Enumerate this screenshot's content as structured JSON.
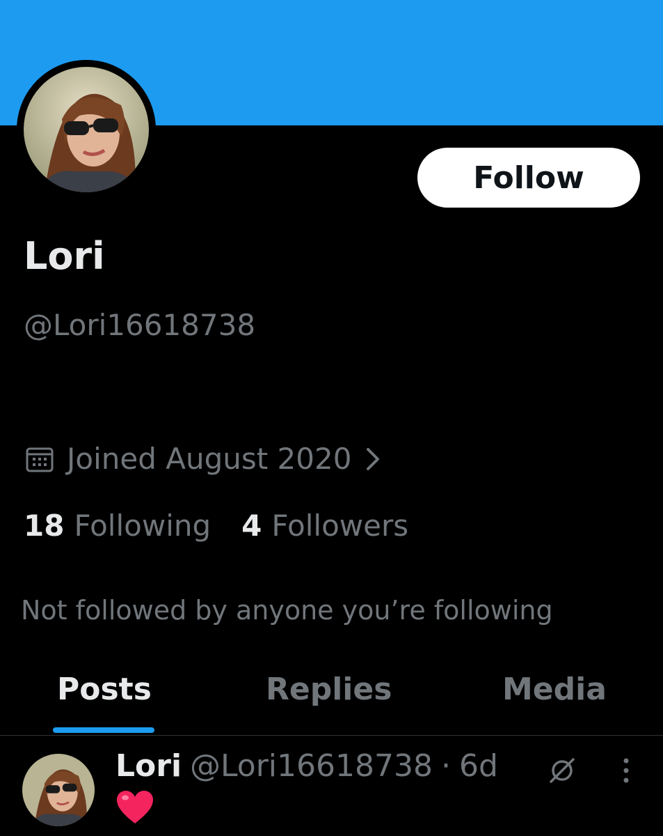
{
  "profile": {
    "display_name": "Lori",
    "handle": "@Lori16618738",
    "joined": "Joined August 2020",
    "following_count": "18",
    "following_label": "Following",
    "followers_count": "4",
    "followers_label": "Followers",
    "mutuals_note": "Not followed by anyone you’re following"
  },
  "actions": {
    "follow_label": "Follow"
  },
  "tabs": [
    {
      "label": "Posts",
      "active": true
    },
    {
      "label": "Replies",
      "active": false
    },
    {
      "label": "Media",
      "active": false
    }
  ],
  "post": {
    "author": "Lori",
    "handle": "@Lori16618738",
    "separator": "·",
    "time": "6d",
    "content": "❤️"
  },
  "colors": {
    "banner": "#1d9bf0",
    "background": "#000000",
    "accent": "#1d9bf0",
    "primary_text": "#e7e9ea",
    "secondary_text": "#71767b",
    "follow_button_bg": "#ffffff",
    "heart": "#f4245e"
  },
  "icons": {
    "joined": "calendar-icon",
    "joined_chevron": "chevron-right-icon",
    "post_action": "grok-icon",
    "post_menu": "more-vertical-icon"
  }
}
